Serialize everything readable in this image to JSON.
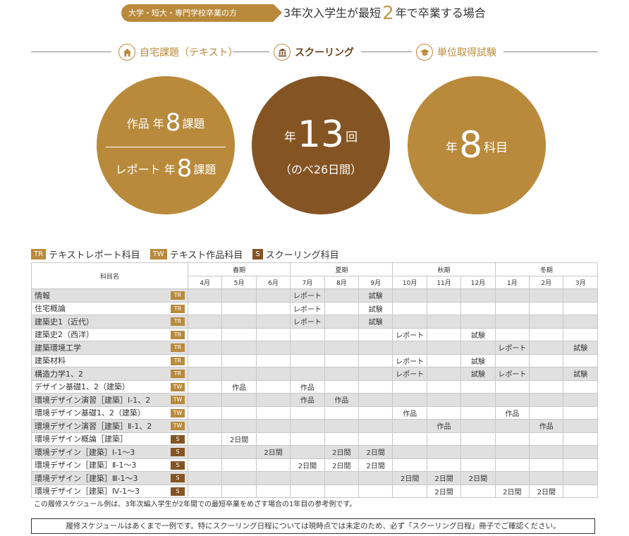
{
  "header": {
    "pill_text": "大学・短大・専門学校卒業の方",
    "headline_pre": "3年次入学生が最短",
    "headline_num": "2",
    "headline_post": "年で卒業する場合"
  },
  "categories": [
    {
      "label": "自宅課題（テキスト）",
      "icon": "home-icon"
    },
    {
      "label": "スクーリング",
      "icon": "building-icon"
    },
    {
      "label": "単位取得試験",
      "icon": "graduation-cap-icon"
    }
  ],
  "circles": {
    "c1": {
      "l1_pre": "作品 年",
      "l1_num": "8",
      "l1_post": "課題",
      "l2_pre": "レポート 年",
      "l2_num": "8",
      "l2_post": "課題"
    },
    "c2": {
      "pre": "年",
      "num": "13",
      "post": "回",
      "sub": "（のべ26日間）"
    },
    "c3": {
      "pre": "年",
      "num": "8",
      "post": "科目"
    }
  },
  "legend": [
    {
      "tag": "TR",
      "label": "テキストレポート科目"
    },
    {
      "tag": "TW",
      "label": "テキスト作品科目"
    },
    {
      "tag": "S",
      "label": "スクーリング科目"
    }
  ],
  "table": {
    "subject_header": "科目名",
    "seasons": [
      "春期",
      "夏期",
      "秋期",
      "冬期"
    ],
    "months": [
      "4月",
      "5月",
      "6月",
      "7月",
      "8月",
      "9月",
      "10月",
      "11月",
      "12月",
      "1月",
      "2月",
      "3月"
    ],
    "rows": [
      {
        "name": "情報",
        "tag": "TR",
        "cells": [
          "",
          "",
          "",
          "レポート",
          "",
          "試験",
          "",
          "",
          "",
          "",
          "",
          ""
        ]
      },
      {
        "name": "住宅概論",
        "tag": "TR",
        "cells": [
          "",
          "",
          "",
          "レポート",
          "",
          "試験",
          "",
          "",
          "",
          "",
          "",
          ""
        ]
      },
      {
        "name": "建築史1（近代）",
        "tag": "TR",
        "cells": [
          "",
          "",
          "",
          "レポート",
          "",
          "試験",
          "",
          "",
          "",
          "",
          "",
          ""
        ]
      },
      {
        "name": "建築史2（西洋）",
        "tag": "TR",
        "cells": [
          "",
          "",
          "",
          "",
          "",
          "",
          "レポート",
          "",
          "試験",
          "",
          "",
          ""
        ]
      },
      {
        "name": "建築環境工学",
        "tag": "TR",
        "cells": [
          "",
          "",
          "",
          "",
          "",
          "",
          "",
          "",
          "",
          "レポート",
          "",
          "試験"
        ]
      },
      {
        "name": "建築材料",
        "tag": "TR",
        "cells": [
          "",
          "",
          "",
          "",
          "",
          "",
          "レポート",
          "",
          "試験",
          "",
          "",
          ""
        ]
      },
      {
        "name": "構造力学1、2",
        "tag": "TR",
        "cells": [
          "",
          "",
          "",
          "",
          "",
          "",
          "レポート",
          "",
          "試験",
          "レポート",
          "",
          "試験"
        ]
      },
      {
        "name": "デザイン基礎1、2（建築）",
        "tag": "TW",
        "cells": [
          "",
          "作品",
          "",
          "作品",
          "",
          "",
          "",
          "",
          "",
          "",
          "",
          ""
        ]
      },
      {
        "name": "環境デザイン演習［建築］Ⅰ-1、2",
        "tag": "TW",
        "cells": [
          "",
          "",
          "",
          "作品",
          "作品",
          "",
          "",
          "",
          "",
          "",
          "",
          ""
        ]
      },
      {
        "name": "環境デザイン基礎1、2（建築）",
        "tag": "TW",
        "cells": [
          "",
          "",
          "",
          "",
          "",
          "",
          "作品",
          "",
          "",
          "作品",
          "",
          ""
        ]
      },
      {
        "name": "環境デザイン演習［建築］Ⅱ-1、2",
        "tag": "TW",
        "cells": [
          "",
          "",
          "",
          "",
          "",
          "",
          "",
          "作品",
          "",
          "",
          "作品",
          ""
        ]
      },
      {
        "name": "環境デザイン概論［建築］",
        "tag": "S",
        "cells": [
          "",
          "2日間",
          "",
          "",
          "",
          "",
          "",
          "",
          "",
          "",
          "",
          ""
        ]
      },
      {
        "name": "環境デザイン［建築］Ⅰ-1〜3",
        "tag": "S",
        "cells": [
          "",
          "",
          "2日間",
          "",
          "2日間",
          "2日間",
          "",
          "",
          "",
          "",
          "",
          ""
        ]
      },
      {
        "name": "環境デザイン［建築］Ⅱ-1〜3",
        "tag": "S",
        "cells": [
          "",
          "",
          "",
          "2日間",
          "2日間",
          "2日間",
          "",
          "",
          "",
          "",
          "",
          ""
        ]
      },
      {
        "name": "環境デザイン［建築］Ⅲ-1〜3",
        "tag": "S",
        "cells": [
          "",
          "",
          "",
          "",
          "",
          "",
          "2日間",
          "2日間",
          "2日間",
          "",
          "",
          ""
        ]
      },
      {
        "name": "環境デザイン［建築］Ⅳ-1〜3",
        "tag": "S",
        "cells": [
          "",
          "",
          "",
          "",
          "",
          "",
          "",
          "2日間",
          "",
          "2日間",
          "2日間",
          ""
        ]
      }
    ]
  },
  "note": "この履修スケジュール例は、3年次編入学生が2年間での最短卒業をめざす場合の1年目の参考例です。",
  "notice": "履修スケジュールはあくまで一例です。特にスクーリング日程については現時点では未定のため、必ず「スクーリング日程」冊子でご確認ください。",
  "colors": {
    "gold": "#b98a3c",
    "brown": "#855423",
    "row_gray": "#e0e0e0"
  }
}
